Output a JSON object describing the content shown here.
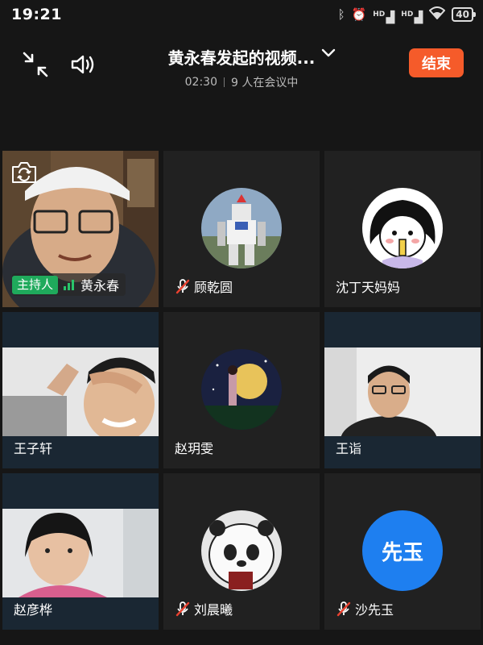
{
  "status_bar": {
    "time": "19:21",
    "battery": "40",
    "hd1": "HD",
    "hd2": "HD"
  },
  "call": {
    "title": "黄永春发起的视频...",
    "duration": "02:30",
    "participant_count": "9 人在会议中",
    "end_label": "结束"
  },
  "participants": [
    {
      "name": "黄永春",
      "host_badge": "主持人",
      "muted": false,
      "video": true
    },
    {
      "name": "顾乾圆",
      "muted": true,
      "video": false
    },
    {
      "name": "沈丁天妈妈",
      "muted": false,
      "video": false
    },
    {
      "name": "王子轩",
      "muted": false,
      "video": true
    },
    {
      "name": "赵玥雯",
      "muted": false,
      "video": false
    },
    {
      "name": "王诣",
      "muted": false,
      "video": true
    },
    {
      "name": "赵彦桦",
      "muted": false,
      "video": true
    },
    {
      "name": "刘晨曦",
      "muted": true,
      "video": false
    },
    {
      "name": "沙先玉",
      "muted": true,
      "video": false,
      "avatar_text": "先玉"
    }
  ],
  "colors": {
    "end_button": "#f55b2a",
    "host_badge": "#1faa5c",
    "text_avatar": "#1e7ff0",
    "mute_red": "#e8412f"
  },
  "icons": [
    "exit-fullscreen-icon",
    "speaker-icon",
    "chevron-down-icon",
    "camera-switch-icon",
    "mic-muted-icon",
    "signal-icon"
  ]
}
